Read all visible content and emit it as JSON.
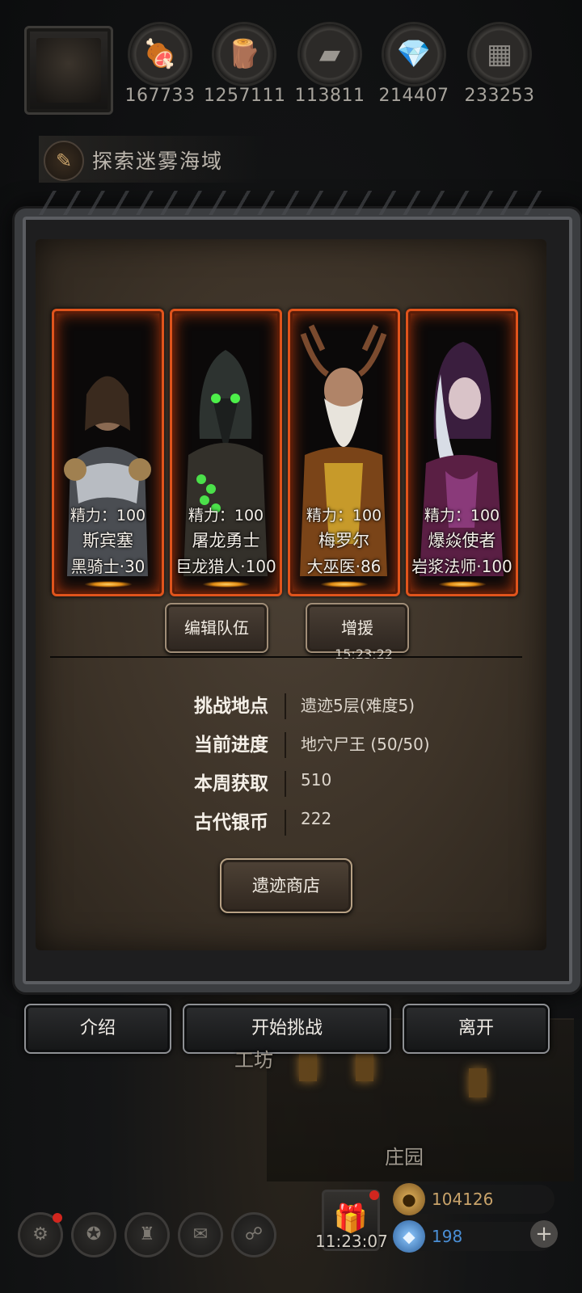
{
  "resources": [
    {
      "icon": "meat-icon",
      "glyph": "🍖",
      "value": "167733"
    },
    {
      "icon": "wood-icon",
      "glyph": "🪵",
      "value": "1257111"
    },
    {
      "icon": "iron-icon",
      "glyph": "▰",
      "value": "113811"
    },
    {
      "icon": "crystal-icon",
      "glyph": "💎",
      "value": "214407"
    },
    {
      "icon": "stone-icon",
      "glyph": "▦",
      "value": "233253"
    }
  ],
  "quest": {
    "label": "探索迷雾海域"
  },
  "heroes": [
    {
      "stamina": "精力：100",
      "name": "斯宾塞",
      "class": "黑骑士·30"
    },
    {
      "stamina": "精力：100",
      "name": "屠龙勇士",
      "class": "巨龙猎人·100"
    },
    {
      "stamina": "精力：100",
      "name": "梅罗尔",
      "class": "大巫医·86"
    },
    {
      "stamina": "精力：100",
      "name": "爆焱使者",
      "class": "岩浆法师·100"
    }
  ],
  "team": {
    "edit_label": "编辑队伍",
    "reinforce_label": "增援",
    "reinforce_timer": "15:23:22"
  },
  "info": [
    {
      "label": "挑战地点",
      "value": "遗迹5层(难度5)"
    },
    {
      "label": "当前进度",
      "value": "地穴尸王 (50/50)"
    },
    {
      "label": "本周获取",
      "value": "510"
    },
    {
      "label": "古代银币",
      "value": "222"
    }
  ],
  "shop_label": "遗迹商店",
  "actions": {
    "intro": "介绍",
    "start": "开始挑战",
    "leave": "离开"
  },
  "places": {
    "workshop": "工坊",
    "manor": "庄园"
  },
  "bottom": {
    "gift_timer": "11:23:07",
    "gold": "104126",
    "gems": "198"
  },
  "colors": {
    "hero_border": "#e0541c",
    "gold": "#c9a36a",
    "gems": "#4a8fd6"
  }
}
